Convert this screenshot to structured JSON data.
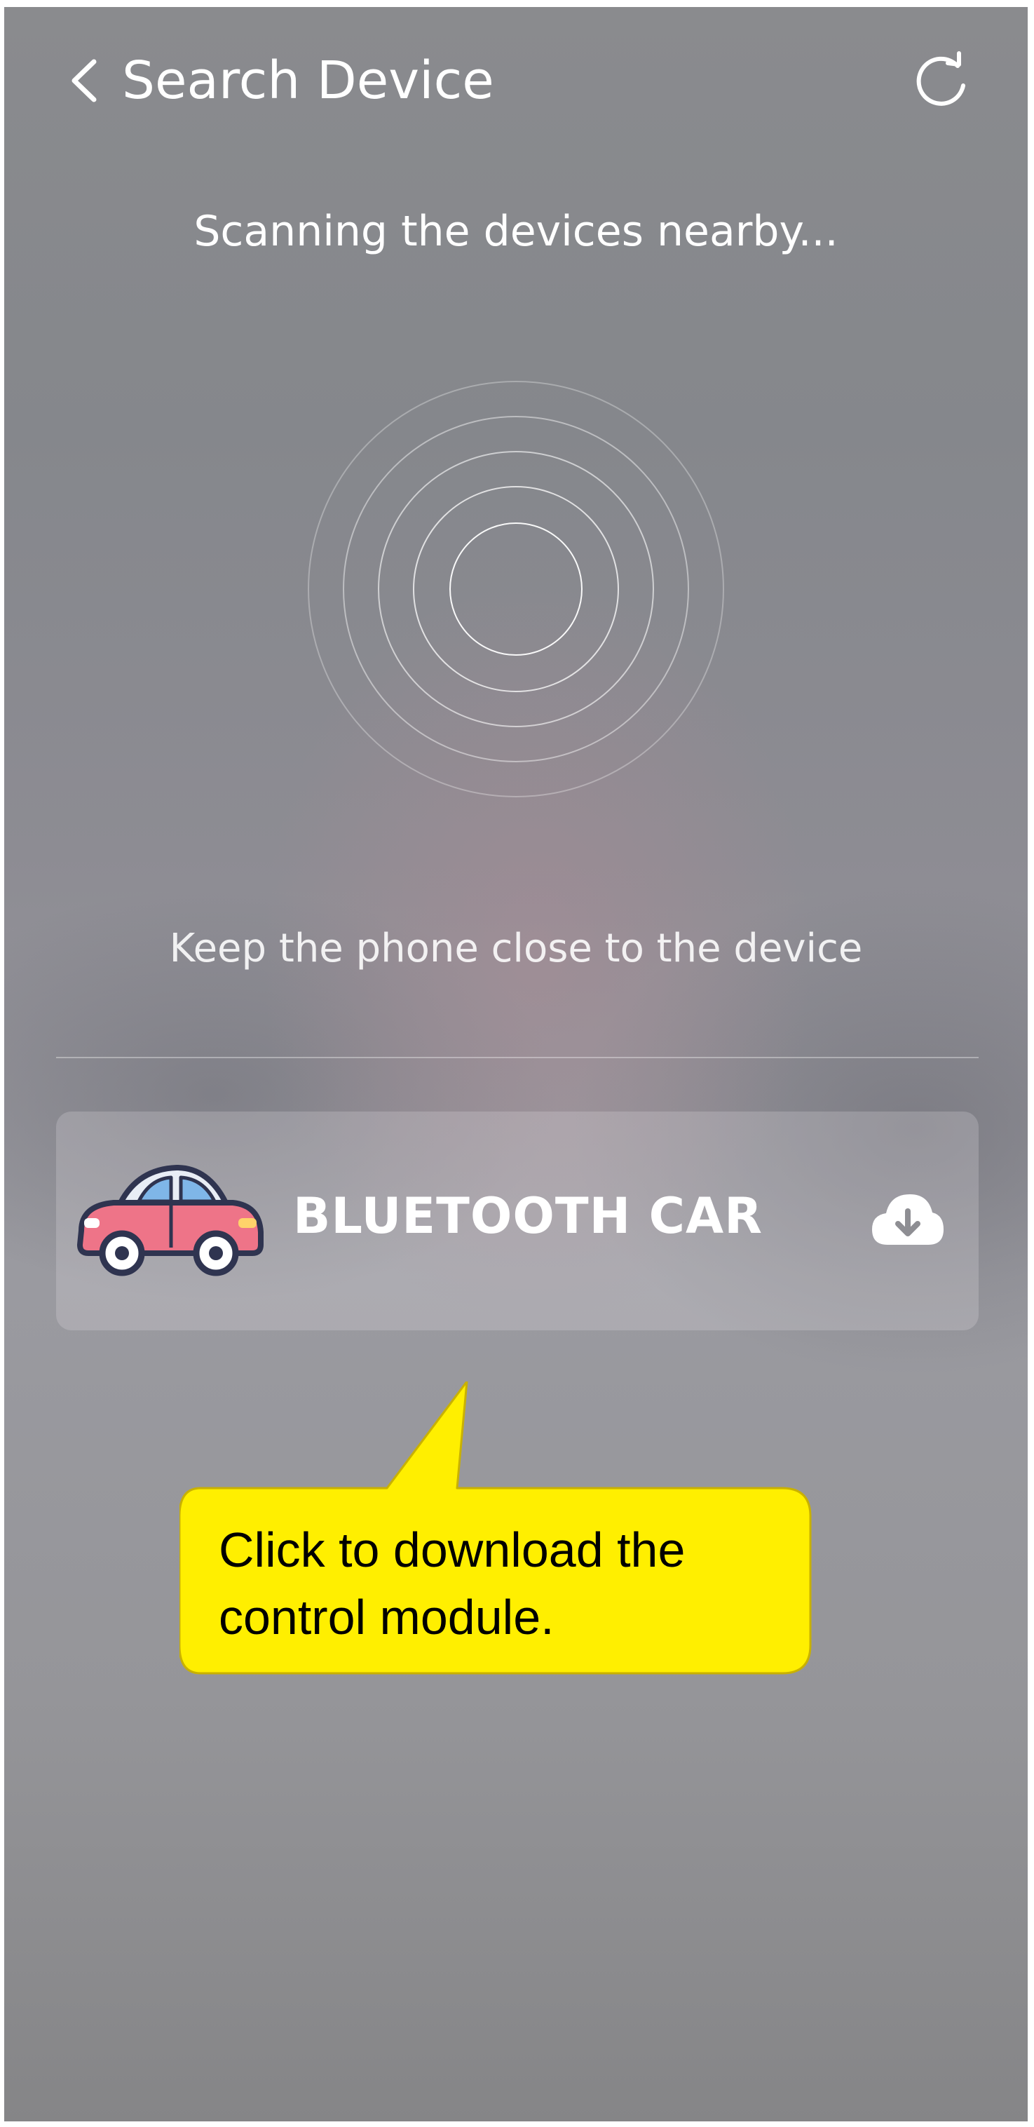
{
  "header": {
    "title": "Search Device"
  },
  "scan": {
    "status": "Scanning the devices nearby...",
    "hint": "Keep the phone close to the device"
  },
  "devices": [
    {
      "name": "BLUETOOTH CAR",
      "icon": "car-icon",
      "action_icon": "cloud-download-icon"
    }
  ],
  "callout": {
    "text": "Click to download the control module.",
    "color": "#FFEF00"
  }
}
